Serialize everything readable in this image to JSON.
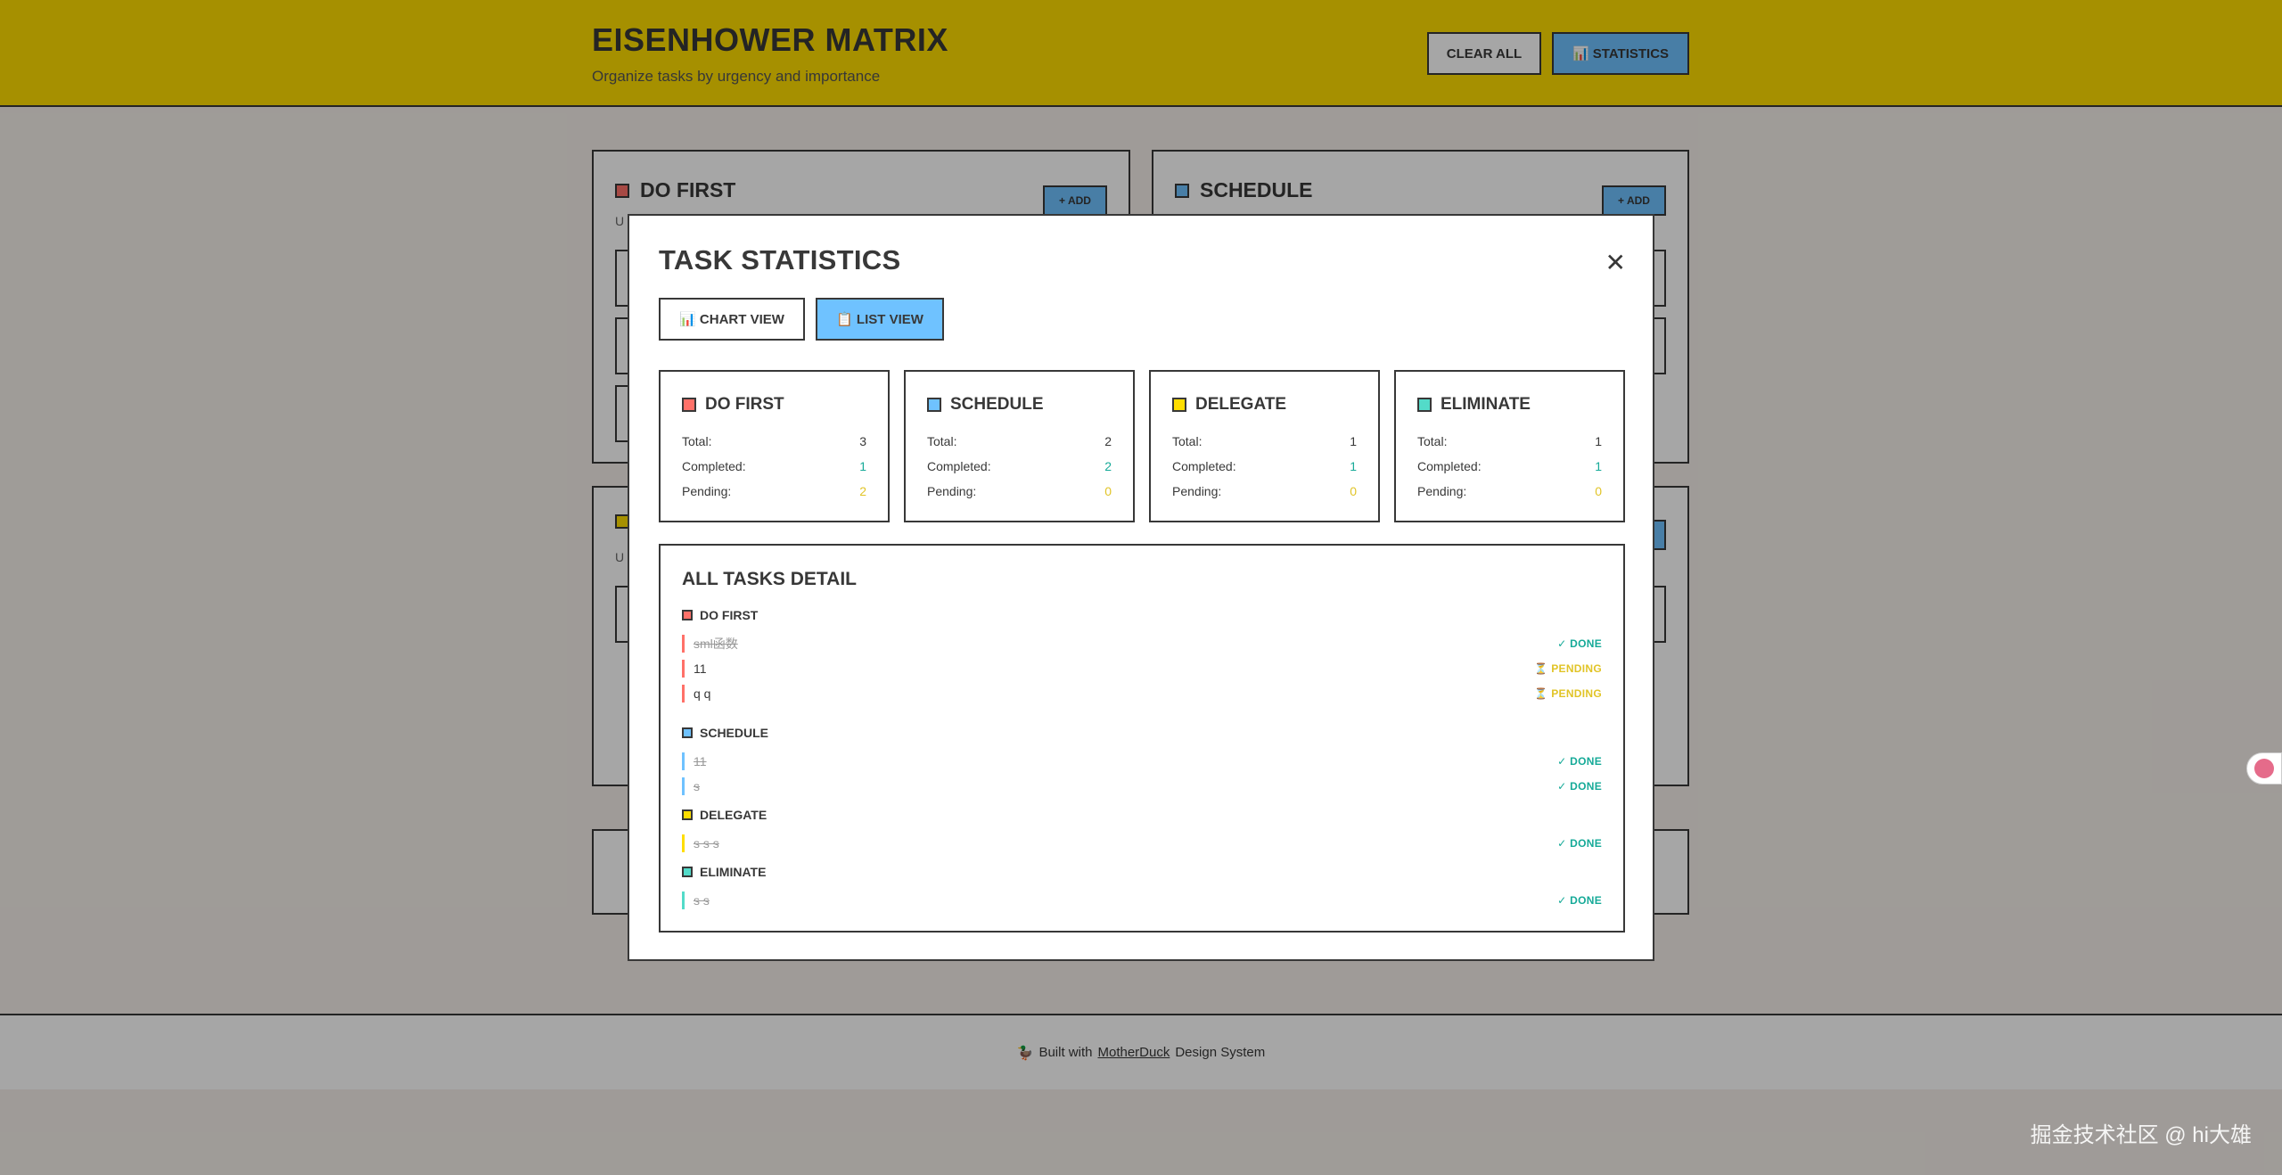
{
  "header": {
    "title": "EISENHOWER MATRIX",
    "subtitle": "Organize tasks by urgency and importance",
    "clear_label": "CLEAR ALL",
    "stats_label": "📊 STATISTICS"
  },
  "quadrants": [
    {
      "title": "DO FIRST",
      "sub": "U",
      "add": "+ ADD",
      "color": "#ff7169"
    },
    {
      "title": "SCHEDULE",
      "sub": "",
      "add": "+ ADD",
      "color": "#6fc2ff"
    },
    {
      "title": "",
      "sub": "U",
      "add": "",
      "color": "#ffde00"
    }
  ],
  "footer": {
    "icon": "🦆",
    "prefix": "Built with",
    "link": "MotherDuck",
    "suffix": "Design System"
  },
  "modal": {
    "title": "TASK STATISTICS",
    "close": "✕",
    "chart_view": "📊 CHART VIEW",
    "list_view": "📋 LIST VIEW",
    "labels": {
      "total": "Total:",
      "completed": "Completed:",
      "pending": "Pending:"
    },
    "cards": [
      {
        "title": "DO FIRST",
        "color": "#ff7169",
        "total": "3",
        "completed": "1",
        "pending": "2"
      },
      {
        "title": "SCHEDULE",
        "color": "#6fc2ff",
        "total": "2",
        "completed": "2",
        "pending": "0"
      },
      {
        "title": "DELEGATE",
        "color": "#ffde00",
        "total": "1",
        "completed": "1",
        "pending": "0"
      },
      {
        "title": "ELIMINATE",
        "color": "#53dbc9",
        "total": "1",
        "completed": "1",
        "pending": "0"
      }
    ],
    "detail": {
      "title": "ALL TASKS DETAIL",
      "groups": [
        {
          "name": "DO FIRST",
          "color": "#ff7169",
          "tasks": [
            {
              "text": "sml函数",
              "status": "✓ DONE",
              "done": true
            },
            {
              "text": "11",
              "status": "⏳ PENDING",
              "done": false
            },
            {
              "text": "q q",
              "status": "⏳ PENDING",
              "done": false
            }
          ]
        },
        {
          "name": "SCHEDULE",
          "color": "#6fc2ff",
          "tasks": [
            {
              "text": "11",
              "status": "✓ DONE",
              "done": true
            },
            {
              "text": "s",
              "status": "✓ DONE",
              "done": true
            }
          ]
        },
        {
          "name": "DELEGATE",
          "color": "#ffde00",
          "tasks": [
            {
              "text": "s s s",
              "status": "✓ DONE",
              "done": true
            }
          ]
        },
        {
          "name": "ELIMINATE",
          "color": "#53dbc9",
          "tasks": [
            {
              "text": "s s",
              "status": "✓ DONE",
              "done": true
            }
          ]
        }
      ]
    }
  },
  "watermark": "掘金技术社区 @ hi大雄"
}
